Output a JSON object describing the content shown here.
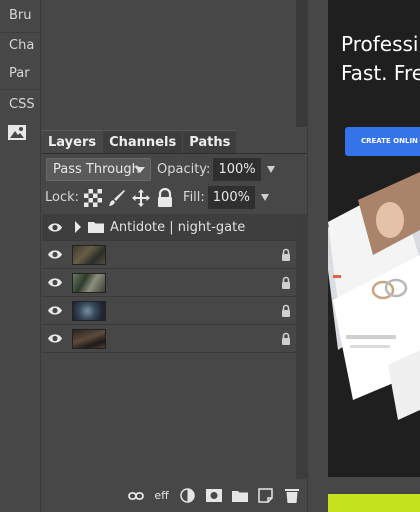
{
  "strip": {
    "items": [
      "Bru",
      "Cha",
      "Par",
      "CSS"
    ]
  },
  "layers_panel": {
    "tabs": [
      "Layers",
      "Channels",
      "Paths"
    ],
    "blend_mode": "Pass Through",
    "opacity_label": "Opacity:",
    "opacity_value": "100%",
    "lock_label": "Lock:",
    "fill_label": "Fill:",
    "fill_value": "100%",
    "group_name": "Antidote | night-gate",
    "layer_count": 4
  },
  "bottom_toolbar": {
    "effects_label": "eff"
  },
  "ad": {
    "headline_line1": "Professi",
    "headline_line2": "Fast. Fre",
    "cta_label": "CREATE ONLIN",
    "accent_color": "#3573e8",
    "lime_color": "#c7e21e"
  }
}
